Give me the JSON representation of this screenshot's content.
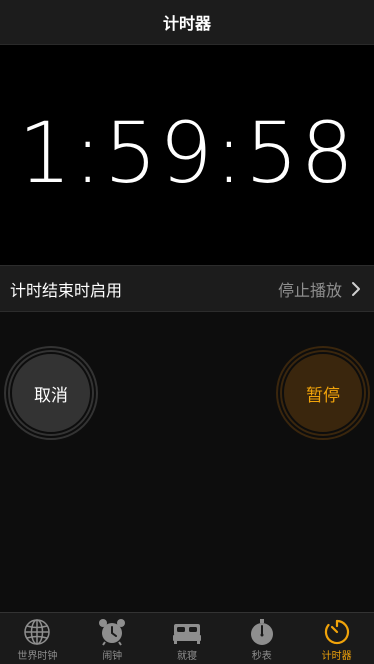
{
  "header": {
    "title": "计时器"
  },
  "timer": {
    "display": "1:59:58"
  },
  "when_timer_ends": {
    "label": "计时结束时启用",
    "value": "停止播放"
  },
  "buttons": {
    "cancel": "取消",
    "pause": "暂停"
  },
  "tabs": [
    {
      "label": "世界时钟",
      "icon": "globe-icon",
      "active": false
    },
    {
      "label": "闹钟",
      "icon": "alarm-clock-icon",
      "active": false
    },
    {
      "label": "就寝",
      "icon": "bed-icon",
      "active": false
    },
    {
      "label": "秒表",
      "icon": "stopwatch-icon",
      "active": false
    },
    {
      "label": "计时器",
      "icon": "timer-icon",
      "active": true
    }
  ],
  "colors": {
    "accent": "#f0a30a",
    "inactive": "#8e8e8e",
    "background": "#000000"
  }
}
